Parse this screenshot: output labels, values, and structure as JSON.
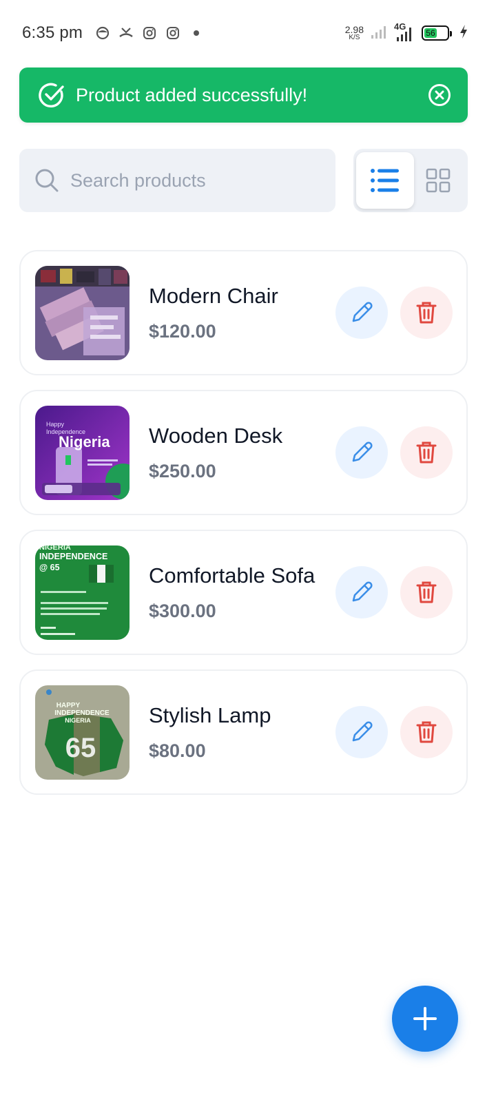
{
  "status_bar": {
    "time": "6:35 pm",
    "net_speed_value": "2.98",
    "net_speed_unit": "K/S",
    "network_type": "4G",
    "battery_level": "56",
    "icons": [
      "face-icon",
      "missed-call-icon",
      "instagram-icon",
      "instagram-icon",
      "dot-icon",
      "signal-icon",
      "signal-4g-icon",
      "battery-icon",
      "charging-icon"
    ]
  },
  "toast": {
    "message": "Product added successfully!",
    "color": "#16b867"
  },
  "search": {
    "placeholder": "Search products",
    "value": ""
  },
  "view_toggle": {
    "active": "list",
    "accent": "#1a7fe8"
  },
  "products": [
    {
      "name": "Modern Chair",
      "price": "$120.00"
    },
    {
      "name": "Wooden Desk",
      "price": "$250.00"
    },
    {
      "name": "Comfortable Sofa",
      "price": "$300.00"
    },
    {
      "name": "Stylish Lamp",
      "price": "$80.00"
    }
  ],
  "thumb_texts": {
    "desk_line1": "Happy",
    "desk_line2": "Independence",
    "desk_title": "Nigeria",
    "sofa_line1": "NIGERIA",
    "sofa_line2": "INDEPENDENCE",
    "sofa_line3": "@ 65",
    "lamp_line1": "HAPPY",
    "lamp_line2": "INDEPENDENCE",
    "lamp_line3": "NIGERIA",
    "lamp_number": "65"
  },
  "colors": {
    "edit": "#3b8ee8",
    "delete": "#e0483f",
    "fab": "#1a7fe8"
  }
}
